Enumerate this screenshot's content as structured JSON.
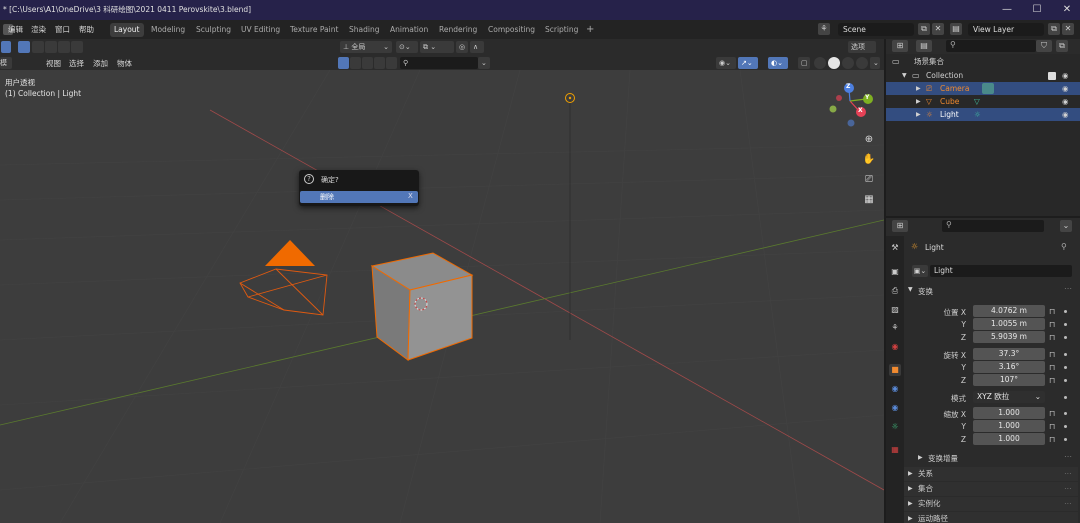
{
  "window": {
    "title": "* [C:\\Users\\A1\\OneDrive\\3 科研绘图\\2021 0411 Perovskite\\3.blend]",
    "minimize": "—",
    "maximize": "☐",
    "close": "✕"
  },
  "menu": {
    "items": [
      "编辑",
      "渲染",
      "窗口",
      "帮助"
    ]
  },
  "workspaces": {
    "tabs": [
      "Layout",
      "Modeling",
      "Sculpting",
      "UV Editing",
      "Texture Paint",
      "Shading",
      "Animation",
      "Rendering",
      "Compositing",
      "Scripting"
    ],
    "active": "Layout",
    "add": "+"
  },
  "scene": {
    "name": "Scene",
    "view_layer": "View Layer"
  },
  "viewport_header": {
    "mode": "模式",
    "menus": [
      "视图",
      "选择",
      "添加",
      "物体"
    ],
    "transform_orientation": "全局",
    "options_label": "选项",
    "search_placeholder": ""
  },
  "viewport": {
    "view_name": "用户透视",
    "collection_path": "(1) Collection | Light",
    "gizmo_axes": {
      "x": "X",
      "y": "Y",
      "z": "Z"
    }
  },
  "dialog": {
    "question": "确定?",
    "option": "删除",
    "shortcut": "X"
  },
  "outliner": {
    "root": "场景集合",
    "collection": "Collection",
    "objects": [
      {
        "name": "Camera",
        "selected": true
      },
      {
        "name": "Cube",
        "selected": false
      },
      {
        "name": "Light",
        "selected": true
      }
    ]
  },
  "properties": {
    "object_name": "Light",
    "data_name": "Light",
    "transform_section": "变换",
    "location_label": "位置 X",
    "rotation_label": "旋转 X",
    "mode_label": "模式",
    "mode_value": "XYZ 欧拉",
    "scale_label": "缩放 X",
    "axis_y": "Y",
    "axis_z": "Z",
    "location": [
      "4.0762 m",
      "1.0055 m",
      "5.9039 m"
    ],
    "rotation": [
      "37.3°",
      "3.16°",
      "107°"
    ],
    "scale": [
      "1.000",
      "1.000",
      "1.000"
    ],
    "delta_transform": "变换增量",
    "sections": [
      "关系",
      "集合",
      "实例化",
      "运动路径"
    ]
  },
  "colors": {
    "selection_orange": "#f06a00",
    "active_blue": "#5277b8",
    "outliner_select": "#334d80",
    "x_axis": "#e64156",
    "y_axis": "#7fb022",
    "z_axis": "#4c7fe0"
  }
}
